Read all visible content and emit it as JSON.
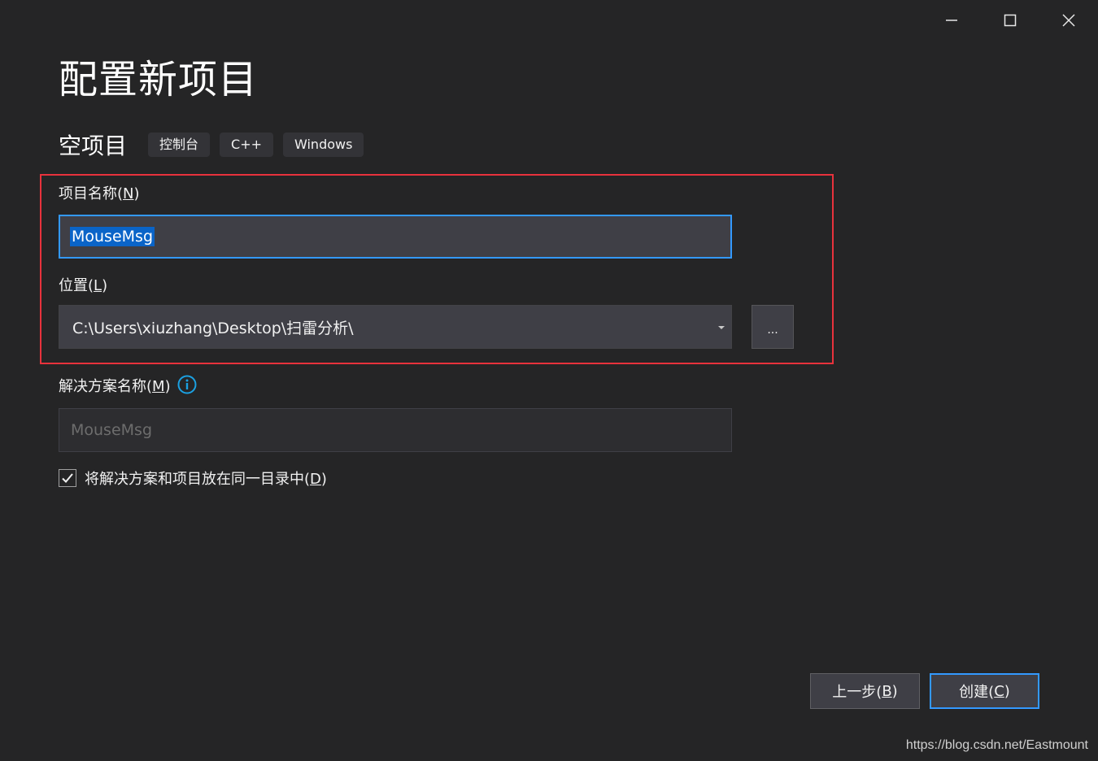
{
  "window": {
    "minimize_icon": "minimize-icon",
    "maximize_icon": "maximize-icon",
    "close_icon": "close-icon"
  },
  "header": {
    "title": "配置新项目"
  },
  "template": {
    "name": "空项目",
    "tags": [
      "控制台",
      "C++",
      "Windows"
    ]
  },
  "project_name": {
    "label_text": "项目名称(",
    "label_accel": "N",
    "label_end": ")",
    "value": "MouseMsg"
  },
  "location": {
    "label_text": "位置(",
    "label_accel": "L",
    "label_end": ")",
    "value": "C:\\Users\\xiuzhang\\Desktop\\扫雷分析\\",
    "browse_label": "..."
  },
  "solution_name": {
    "label_text": "解决方案名称(",
    "label_accel": "M",
    "label_end": ")",
    "placeholder": "MouseMsg",
    "info_icon": "info-icon"
  },
  "same_directory": {
    "checked": true,
    "label_text": "将解决方案和项目放在同一目录中(",
    "label_accel": "D",
    "label_end": ")"
  },
  "footer": {
    "back_text": "上一步(",
    "back_accel": "B",
    "back_end": ")",
    "create_text": "创建(",
    "create_accel": "C",
    "create_end": ")"
  },
  "watermark": "https://blog.csdn.net/Eastmount",
  "colors": {
    "background": "#252526",
    "accent": "#3399ff",
    "highlight_border": "#e8323c",
    "input_bg": "#3f3f46"
  }
}
